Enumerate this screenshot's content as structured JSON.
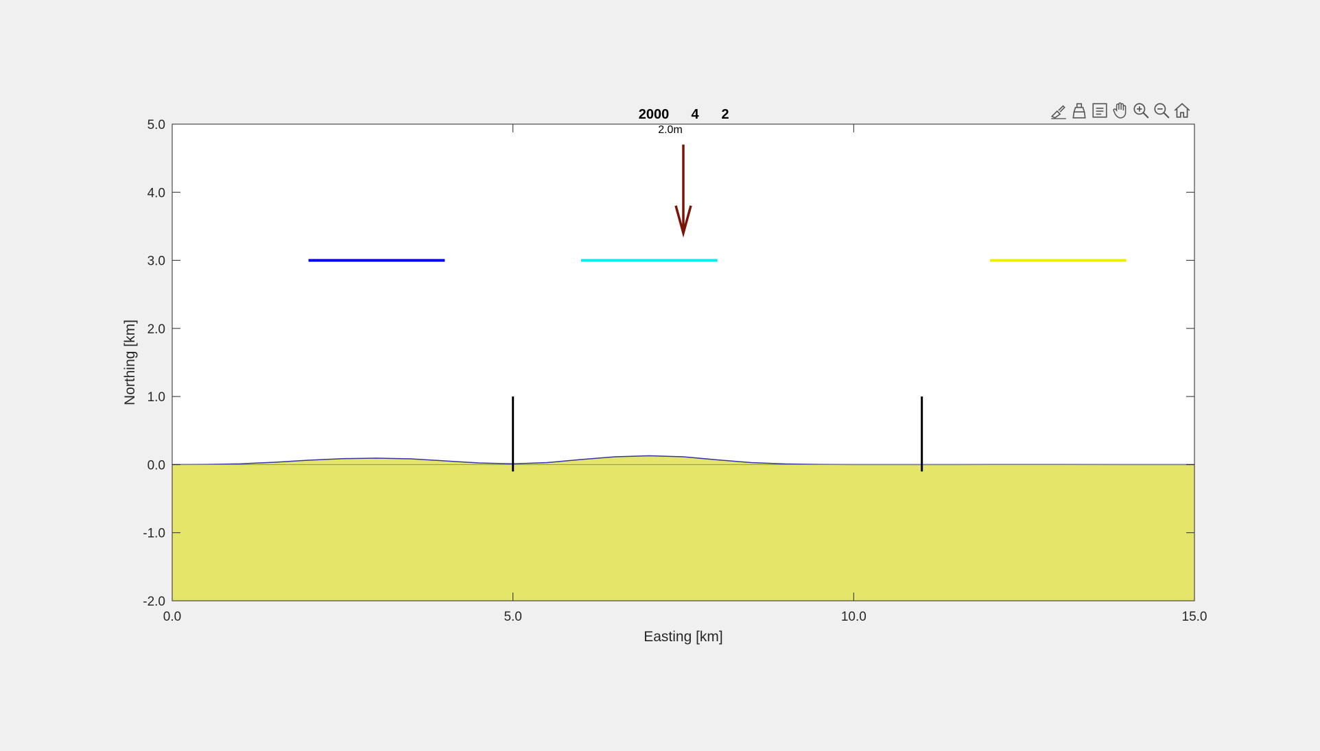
{
  "toolbar": {
    "icons": [
      "brush-icon",
      "eraser-icon",
      "legend-icon",
      "pan-hand-icon",
      "zoom-in-icon",
      "zoom-out-icon",
      "home-icon"
    ]
  },
  "colors": {
    "background": "#f0f0f0",
    "plot_area": "#ffffff",
    "ground_fill": "#e5e56a",
    "surface_line": "#3333aa",
    "arrow": "#7a1505",
    "axis": "#262626"
  },
  "chart_data": {
    "type": "line",
    "title_parts": [
      "2000",
      "4",
      "2"
    ],
    "scale_label": "2.0m",
    "xlabel": "Easting [km]",
    "ylabel": "Northing [km]",
    "xlim": [
      0,
      15
    ],
    "ylim": [
      -2,
      5
    ],
    "xticks": [
      0,
      5,
      10,
      15
    ],
    "xtick_labels": [
      "0.0",
      "5.0",
      "10.0",
      "15.0"
    ],
    "yticks": [
      5,
      4,
      3,
      2,
      1,
      0,
      -1,
      -2
    ],
    "ytick_labels": [
      "5.0",
      "4.0",
      "3.0",
      "2.0",
      "1.0",
      "0.0",
      "-1.0",
      "-2.0"
    ],
    "ground_top": 0,
    "segments": [
      {
        "color": "#0000ee",
        "x": [
          2,
          4
        ],
        "y": [
          3,
          3
        ]
      },
      {
        "color": "#00eeee",
        "x": [
          6,
          8
        ],
        "y": [
          3,
          3
        ]
      },
      {
        "color": "#eeee00",
        "x": [
          12,
          14
        ],
        "y": [
          3,
          3
        ]
      }
    ],
    "vertical_markers": [
      {
        "x": 5,
        "y": [
          -0.1,
          1.0
        ]
      },
      {
        "x": 11,
        "y": [
          -0.1,
          1.0
        ]
      }
    ],
    "arrow": {
      "x": 7.5,
      "y_from": 4.7,
      "y_to": 3.4
    },
    "surface_profile": {
      "x": [
        0,
        0.5,
        1,
        1.5,
        2,
        2.5,
        3,
        3.5,
        4,
        4.5,
        5,
        5.5,
        6,
        6.5,
        7,
        7.5,
        8,
        8.5,
        9,
        9.5,
        10,
        11,
        12,
        13,
        14,
        15
      ],
      "y": [
        0,
        0.003,
        0.012,
        0.035,
        0.065,
        0.088,
        0.095,
        0.085,
        0.055,
        0.025,
        0.012,
        0.03,
        0.075,
        0.115,
        0.13,
        0.115,
        0.07,
        0.03,
        0.01,
        0.003,
        0,
        0,
        0.002,
        0.002,
        0.001,
        0
      ]
    }
  }
}
